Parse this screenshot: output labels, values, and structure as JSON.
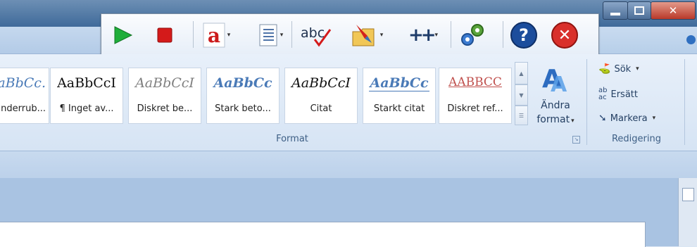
{
  "toolbar": {
    "buttons": [
      "play-icon",
      "stop-icon",
      "font-color-icon",
      "document-list-icon",
      "spellcheck-icon",
      "folder-pen-icon",
      "add-icon",
      "gears-icon",
      "help-icon",
      "close-icon"
    ],
    "spellcheck_text": "abc",
    "help_text": "?",
    "play_color": "#1fae3a",
    "stop_color": "#d41a1a",
    "help_color": "#1c4d9c",
    "close_color": "#d9302b"
  },
  "styles": {
    "cards": [
      {
        "sample": "AaBbCc.",
        "name": "Underrub..."
      },
      {
        "sample": "AaBbCcI",
        "name": "¶ Inget av..."
      },
      {
        "sample": "AaBbCcI",
        "name": "Diskret be..."
      },
      {
        "sample": "AaBbCc",
        "name": "Stark beto..."
      },
      {
        "sample": "AaBbCcI",
        "name": "Citat"
      },
      {
        "sample": "AaBbCc",
        "name": "Starkt citat"
      },
      {
        "sample": "AABBCC",
        "name": "Diskret ref..."
      }
    ],
    "change_format_line1": "Ändra",
    "change_format_line2": "format",
    "group_label": "Format"
  },
  "editing": {
    "find_label": "Sök",
    "replace_label": "Ersätt",
    "select_label": "Markera",
    "group_label": "Redigering"
  }
}
